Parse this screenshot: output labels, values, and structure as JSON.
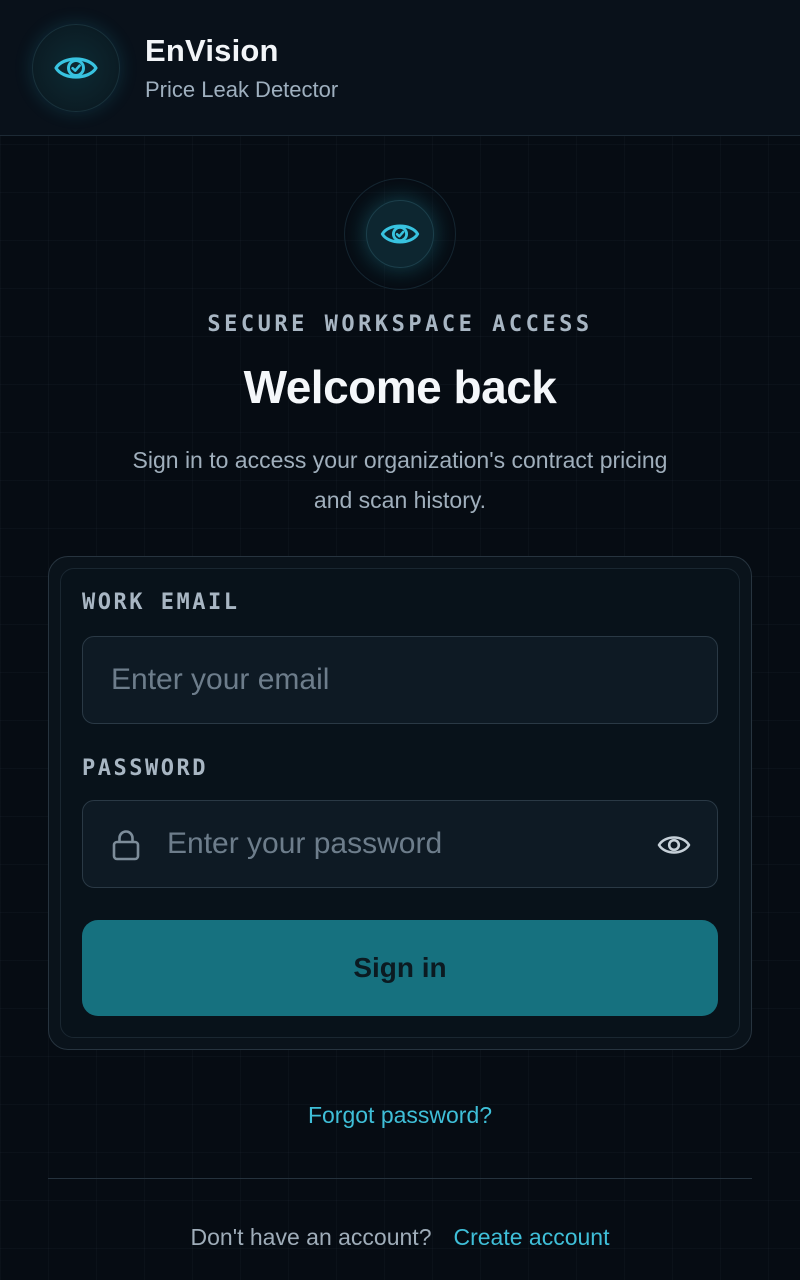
{
  "header": {
    "title": "EnVision",
    "subtitle": "Price Leak Detector",
    "logo_icon": "eye-check-icon"
  },
  "hero": {
    "icon": "eye-check-icon",
    "eyebrow": "SECURE WORKSPACE ACCESS",
    "title": "Welcome back",
    "description": "Sign in to access your organization's contract pricing and scan history."
  },
  "form": {
    "email": {
      "label": "WORK EMAIL",
      "placeholder": "Enter your email",
      "value": ""
    },
    "password": {
      "label": "PASSWORD",
      "placeholder": "Enter your password",
      "value": "",
      "leading_icon": "lock-icon",
      "toggle_icon": "eye-icon"
    },
    "submit_label": "Sign in"
  },
  "links": {
    "forgot_password": "Forgot password?",
    "signup_prompt": "Don't have an account?",
    "signup_link": "Create account"
  },
  "colors": {
    "background": "#060c13",
    "accent": "#3fbfd8",
    "button": "#16717f"
  }
}
